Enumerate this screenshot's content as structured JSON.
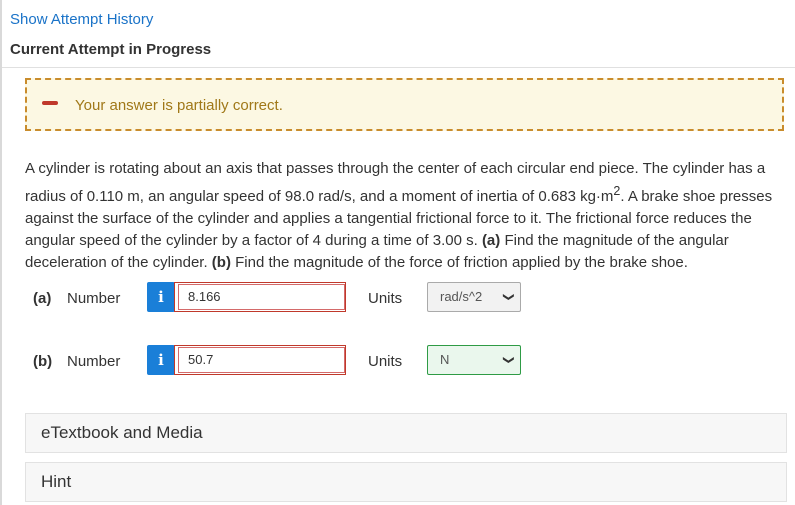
{
  "header": {
    "show_history": "Show Attempt History",
    "attempt_title": "Current Attempt in Progress"
  },
  "alert": {
    "message": "Your answer is partially correct."
  },
  "question": {
    "t1": "A cylinder is rotating about an axis that passes through the center of each circular end piece. The cylinder has a radius of 0.110 m, an angular speed of 98.0 rad/s, and a moment of inertia of 0.683 kg·m",
    "sup": "2",
    "t2": ". A brake shoe presses against the surface of the cylinder and applies a tangential frictional force to it. The frictional force reduces the angular speed of the cylinder by a factor of 4 during a time of 3.00 s. ",
    "a_label": "(a)",
    "t3": " Find the magnitude of the angular deceleration of the cylinder. ",
    "b_label": "(b)",
    "t4": " Find the magnitude of the force of friction applied by the brake shoe."
  },
  "answers": [
    {
      "part": "(a)",
      "number_label": "Number",
      "info": "i",
      "value": "8.166",
      "units_label": "Units",
      "unit": "rad/s^2",
      "unit_status": "correct"
    },
    {
      "part": "(b)",
      "number_label": "Number",
      "info": "i",
      "value": "50.7",
      "units_label": "Units",
      "unit": "N",
      "unit_status": "correct"
    }
  ],
  "panels": {
    "etextbook": "eTextbook and Media",
    "hint": "Hint"
  },
  "colors": {
    "link": "#1a73c8",
    "alert_border": "#c98c2c",
    "alert_bg": "#fcf8e3",
    "incorrect": "#c0392b",
    "correct": "#2e9b45",
    "info": "#1a7fd8"
  }
}
